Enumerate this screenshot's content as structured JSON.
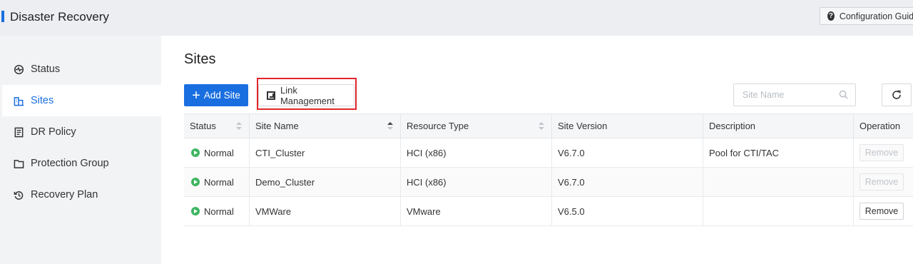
{
  "app": {
    "title": "Disaster Recovery",
    "guide_label": "Configuration Guide"
  },
  "sidebar": {
    "items": [
      {
        "label": "Status",
        "icon": "status-icon",
        "active": false
      },
      {
        "label": "Sites",
        "icon": "sites-icon",
        "active": true
      },
      {
        "label": "DR Policy",
        "icon": "dr-policy-icon",
        "active": false
      },
      {
        "label": "Protection Group",
        "icon": "protection-group-icon",
        "active": false
      },
      {
        "label": "Recovery Plan",
        "icon": "recovery-plan-icon",
        "active": false
      }
    ]
  },
  "main": {
    "title": "Sites",
    "add_label": "Add Site",
    "link_label": "Link Management",
    "search_placeholder": "Site Name"
  },
  "table": {
    "columns": [
      "Status",
      "Site Name",
      "Resource Type",
      "Site Version",
      "Description",
      "Operation"
    ],
    "rows": [
      {
        "status": "Normal",
        "name": "CTI_Cluster",
        "type": "HCI (x86)",
        "version": "V6.7.0",
        "description": "Pool for CTI/TAC",
        "op": "Remove",
        "op_enabled": false
      },
      {
        "status": "Normal",
        "name": "Demo_Cluster",
        "type": "HCI (x86)",
        "version": "V6.7.0",
        "description": "",
        "op": "Remove",
        "op_enabled": false
      },
      {
        "status": "Normal",
        "name": "VMWare",
        "type": "VMware",
        "version": "V6.5.0",
        "description": "",
        "op": "Remove",
        "op_enabled": true
      }
    ]
  },
  "colors": {
    "accent": "#1a6fe0",
    "status_normal": "#3fb561",
    "highlight": "#e0262a"
  }
}
